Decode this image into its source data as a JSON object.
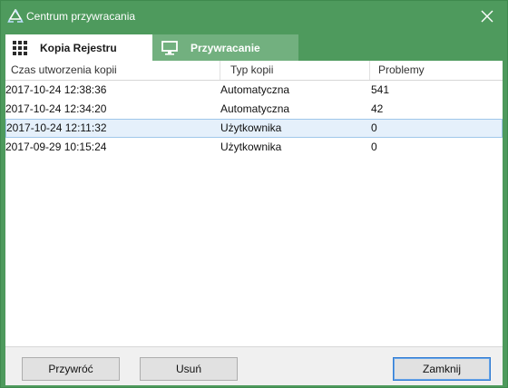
{
  "window": {
    "title": "Centrum przywracania"
  },
  "icons": {
    "app": "recycle-arrows-icon",
    "close": "close-icon",
    "grid": "grid-icon",
    "monitor": "monitor-icon"
  },
  "tabs": [
    {
      "label": "Kopia Rejestru",
      "icon": "grid-icon",
      "active": true
    },
    {
      "label": "Przywracanie",
      "icon": "monitor-icon",
      "active": false
    }
  ],
  "table": {
    "columns": [
      "Czas utworzenia kopii",
      "Typ kopii",
      "Problemy"
    ],
    "rows": [
      {
        "time": "2017-10-24 12:38:36",
        "type": "Automatyczna",
        "problems": "541"
      },
      {
        "time": "2017-10-24 12:34:20",
        "type": "Automatyczna",
        "problems": "42"
      },
      {
        "time": "2017-10-24 12:11:32",
        "type": "Użytkownika",
        "problems": "0",
        "selected": true
      },
      {
        "time": "2017-09-29 10:15:24",
        "type": "Użytkownika",
        "problems": "0"
      }
    ]
  },
  "buttons": {
    "restore": "Przywróć",
    "delete": "Usuń",
    "close": "Zamknij"
  },
  "colors": {
    "frame": "#4e9a5d",
    "inactive_tab": "#72b07f",
    "selection": "#e5f0fb",
    "default_button_border": "#2f7bd3"
  }
}
